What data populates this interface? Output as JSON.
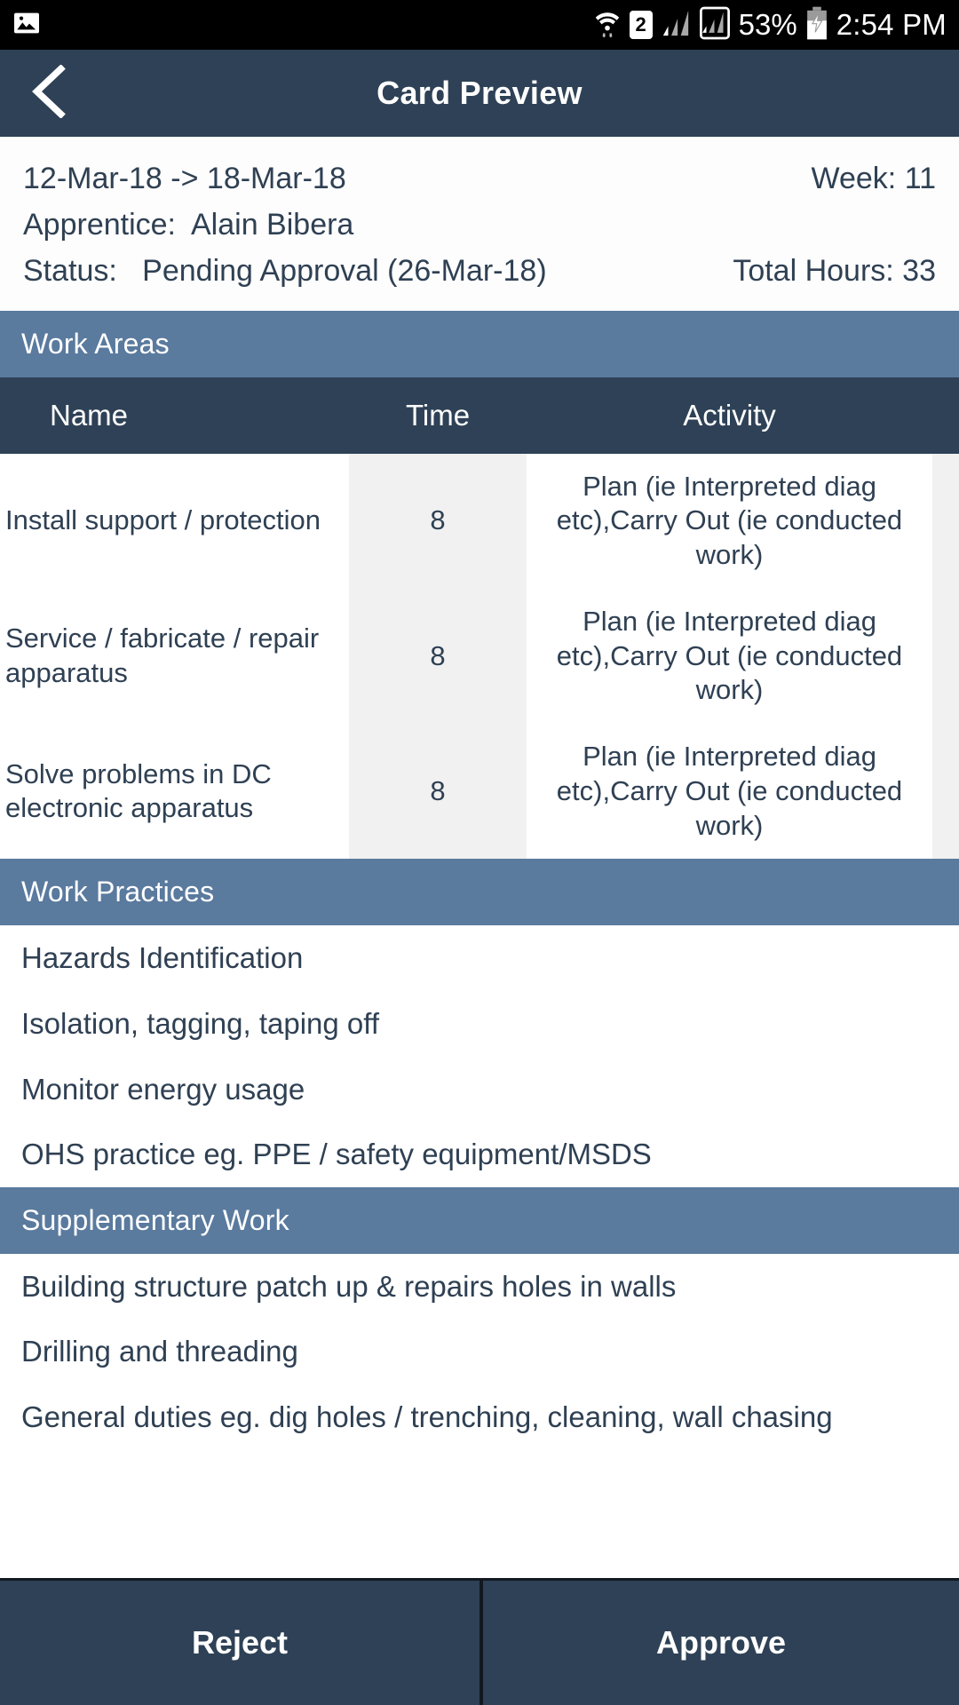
{
  "status_bar": {
    "photo_icon": "photo-icon",
    "wifi_icon": "wifi-icon",
    "sim_badge": "2",
    "signal_icon_1": "signal-bars-icon",
    "signal_icon_2": "signal-bars-boxed-icon",
    "battery_percent": "53%",
    "battery_icon": "battery-charging-icon",
    "clock": "2:54 PM"
  },
  "appbar": {
    "back_icon": "back-chevron-icon",
    "title": "Card Preview"
  },
  "summary": {
    "date_range": "12-Mar-18 -> 18-Mar-18",
    "week": "Week: 11",
    "apprentice": "Apprentice:  Alain Bibera",
    "status": "Status:   Pending Approval (26-Mar-18)",
    "total_hours": "Total Hours: 33"
  },
  "work_areas": {
    "section_title": "Work Areas",
    "columns": [
      "Name",
      "Time",
      "Activity"
    ],
    "rows": [
      {
        "name": "Install support / protection",
        "time": "8",
        "activity": "Plan (ie Interpreted diag etc),Carry Out (ie conducted work)"
      },
      {
        "name": "Service / fabricate / repair apparatus",
        "time": "8",
        "activity": "Plan (ie Interpreted diag etc),Carry Out (ie conducted work)"
      },
      {
        "name": "Solve problems in DC electronic apparatus",
        "time": "8",
        "activity": "Plan (ie Interpreted diag etc),Carry Out (ie conducted work)"
      }
    ]
  },
  "work_practices": {
    "section_title": "Work Practices",
    "items": [
      "Hazards Identification",
      "Isolation, tagging, taping off",
      "Monitor energy usage",
      "OHS practice eg. PPE / safety equipment/MSDS"
    ]
  },
  "supplementary_work": {
    "section_title": "Supplementary Work",
    "items": [
      "Building structure patch up & repairs holes in walls",
      "Drilling and threading",
      "General duties eg. dig holes / trenching, cleaning, wall chasing"
    ]
  },
  "actions": {
    "reject_label": "Reject",
    "approve_label": "Approve"
  },
  "colors": {
    "appbar": "#2e4156",
    "section_header": "#5a7a9e",
    "table_header": "#2e4156",
    "text": "#2f4053",
    "time_column": "#f1f1f1",
    "button": "#2e4156"
  }
}
